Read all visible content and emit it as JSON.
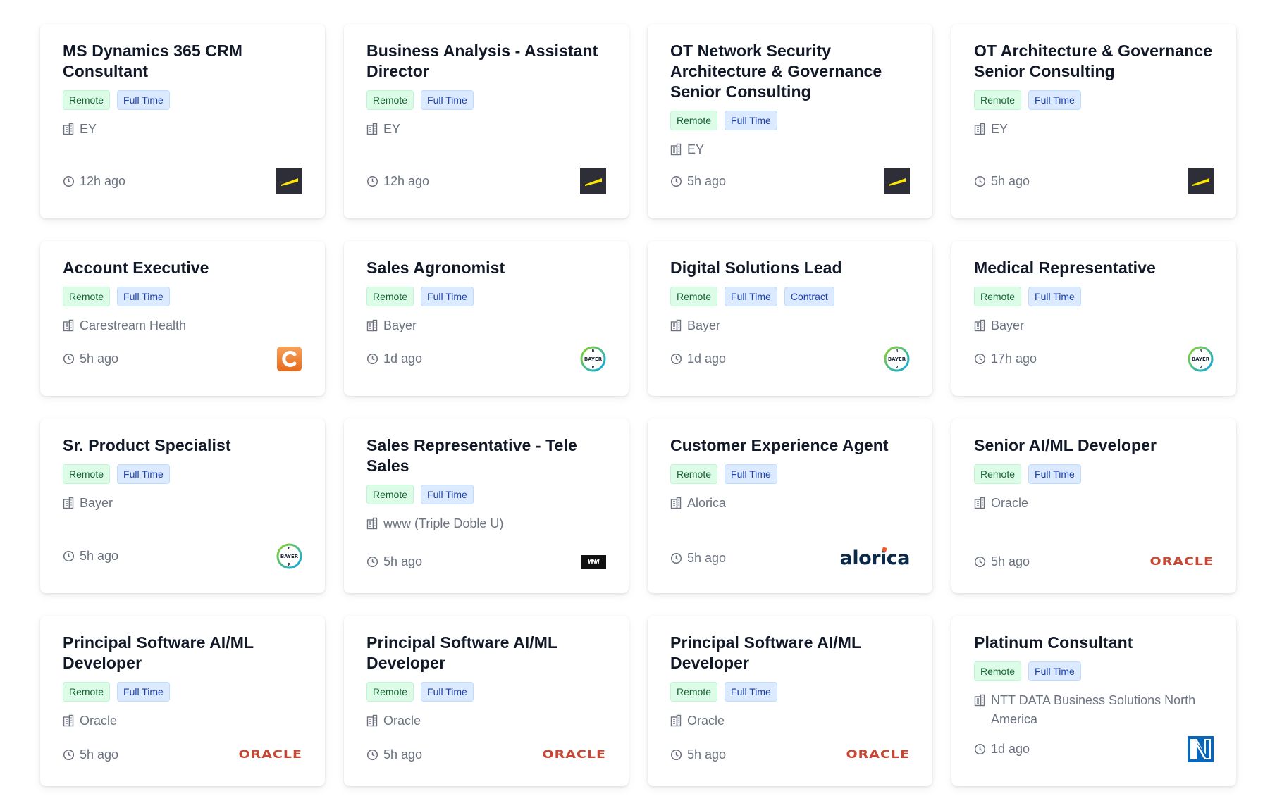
{
  "jobs": [
    {
      "title": "MS Dynamics 365 CRM Consultant",
      "tags": [
        "Remote",
        "Full Time"
      ],
      "company": "EY",
      "time": "12h ago",
      "logo": "ey"
    },
    {
      "title": "Business Analysis - Assistant Director",
      "tags": [
        "Remote",
        "Full Time"
      ],
      "company": "EY",
      "time": "12h ago",
      "logo": "ey"
    },
    {
      "title": "OT Network Security Architecture & Governance Senior Consulting",
      "tags": [
        "Remote",
        "Full Time"
      ],
      "company": "EY",
      "time": "5h ago",
      "logo": "ey"
    },
    {
      "title": "OT Architecture & Governance Senior Consulting",
      "tags": [
        "Remote",
        "Full Time"
      ],
      "company": "EY",
      "time": "5h ago",
      "logo": "ey"
    },
    {
      "title": "Account Executive",
      "tags": [
        "Remote",
        "Full Time"
      ],
      "company": "Carestream Health",
      "time": "5h ago",
      "logo": "carestream"
    },
    {
      "title": "Sales Agronomist",
      "tags": [
        "Remote",
        "Full Time"
      ],
      "company": "Bayer",
      "time": "1d ago",
      "logo": "bayer"
    },
    {
      "title": "Digital Solutions Lead",
      "tags": [
        "Remote",
        "Full Time",
        "Contract"
      ],
      "company": "Bayer",
      "time": "1d ago",
      "logo": "bayer"
    },
    {
      "title": "Medical Representative",
      "tags": [
        "Remote",
        "Full Time"
      ],
      "company": "Bayer",
      "time": "17h ago",
      "logo": "bayer"
    },
    {
      "title": "Sr. Product Specialist",
      "tags": [
        "Remote",
        "Full Time"
      ],
      "company": "Bayer",
      "time": "5h ago",
      "logo": "bayer"
    },
    {
      "title": "Sales Representative - Tele Sales",
      "tags": [
        "Remote",
        "Full Time"
      ],
      "company": "www (Triple Doble U)",
      "time": "5h ago",
      "logo": "www"
    },
    {
      "title": "Customer Experience Agent",
      "tags": [
        "Remote",
        "Full Time"
      ],
      "company": "Alorica",
      "time": "5h ago",
      "logo": "alorica"
    },
    {
      "title": "Senior AI/ML Developer",
      "tags": [
        "Remote",
        "Full Time"
      ],
      "company": "Oracle",
      "time": "5h ago",
      "logo": "oracle"
    },
    {
      "title": "Principal Software AI/ML Developer",
      "tags": [
        "Remote",
        "Full Time"
      ],
      "company": "Oracle",
      "time": "5h ago",
      "logo": "oracle"
    },
    {
      "title": "Principal Software AI/ML Developer",
      "tags": [
        "Remote",
        "Full Time"
      ],
      "company": "Oracle",
      "time": "5h ago",
      "logo": "oracle"
    },
    {
      "title": "Principal Software AI/ML Developer",
      "tags": [
        "Remote",
        "Full Time"
      ],
      "company": "Oracle",
      "time": "5h ago",
      "logo": "oracle"
    },
    {
      "title": "Platinum Consultant",
      "tags": [
        "Remote",
        "Full Time"
      ],
      "company": "NTT DATA Business Solutions North America",
      "time": "1d ago",
      "logo": "ntt"
    }
  ],
  "logo_text": {
    "bayer": "BAYER",
    "www": "WWW",
    "alorica": "alorica",
    "oracle": "ORACLE"
  },
  "colors": {
    "remote_bg": "#dcfce7",
    "remote_text": "#166534",
    "fulltime_bg": "#dbeafe",
    "fulltime_text": "#1e40af",
    "oracle_red": "#c74634",
    "ey_yellow": "#ffe600",
    "bayer_green": "#89d329",
    "bayer_blue": "#10a5e8"
  }
}
